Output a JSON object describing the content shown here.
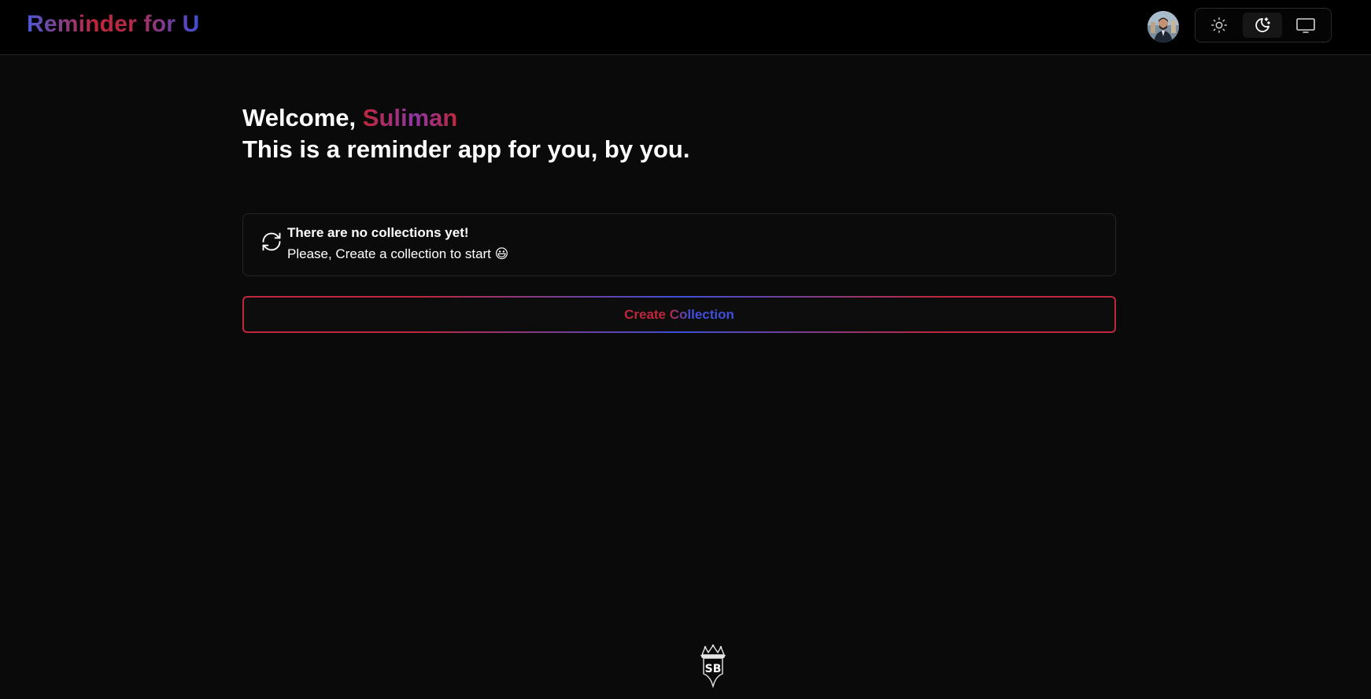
{
  "header": {
    "brand": "Reminder for U",
    "avatar_alt": "User avatar",
    "theme_options": [
      "light",
      "dark",
      "system"
    ],
    "active_theme": "dark"
  },
  "main": {
    "welcome_prefix": "Welcome, ",
    "user_name": "Suliman",
    "tagline": "This is a reminder app for you, by you."
  },
  "empty_state": {
    "title": "There are no collections yet!",
    "message": "Please, Create a collection to start 😃",
    "icon": "refresh-icon"
  },
  "actions": {
    "create_collection_label": "Create Collection"
  },
  "footer": {
    "logo_text": "SB"
  },
  "colors": {
    "accent_red": "#c0263c",
    "accent_blue": "#3f4fd9",
    "background": "#0a0a0a"
  }
}
